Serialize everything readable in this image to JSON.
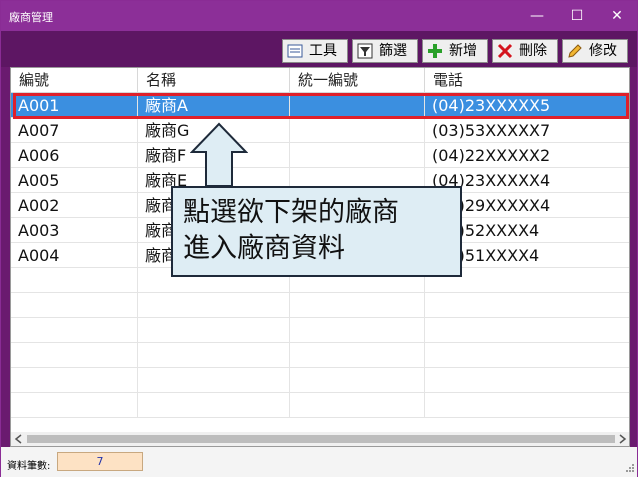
{
  "window": {
    "title": "廠商管理",
    "minimize_icon": "minimize-icon",
    "maximize_icon": "maximize-icon",
    "close_icon": "close-icon"
  },
  "toolbar": [
    {
      "label": "工具",
      "icon": "tools-icon"
    },
    {
      "label": "篩選",
      "icon": "filter-icon"
    },
    {
      "label": "新增",
      "icon": "plus-icon",
      "color": "#2aa02a"
    },
    {
      "label": "刪除",
      "icon": "x-icon",
      "color": "#d4141e"
    },
    {
      "label": "修改",
      "icon": "pencil-icon",
      "color": "#e6a21a"
    }
  ],
  "table": {
    "columns": [
      "編號",
      "名稱",
      "統一編號",
      "電話"
    ],
    "rows": [
      [
        "A001",
        "廠商A",
        "",
        "(04)23XXXXX5"
      ],
      [
        "A007",
        "廠商G",
        "",
        "(03)53XXXXX7"
      ],
      [
        "A006",
        "廠商F",
        "",
        "(04)22XXXXX2"
      ],
      [
        "A005",
        "廠商E",
        "",
        "(04)23XXXXX4"
      ],
      [
        "A002",
        "廠商B",
        "",
        "(04)29XXXXX4"
      ],
      [
        "A003",
        "廠商C",
        "",
        "(04)52XXXX4"
      ],
      [
        "A004",
        "廠商D",
        "",
        "(04)51XXXX4"
      ]
    ],
    "selected_index": 0
  },
  "status": {
    "label": "資料筆數:",
    "count": "7"
  },
  "callout": {
    "line1": "點選欲下架的廠商",
    "line2": "進入廠商資料"
  },
  "colors": {
    "titlebar": "#8c2f98",
    "selection": "#3b8fe0",
    "highlight_outline": "#e0202a",
    "callout_bg": "#deedf4"
  }
}
